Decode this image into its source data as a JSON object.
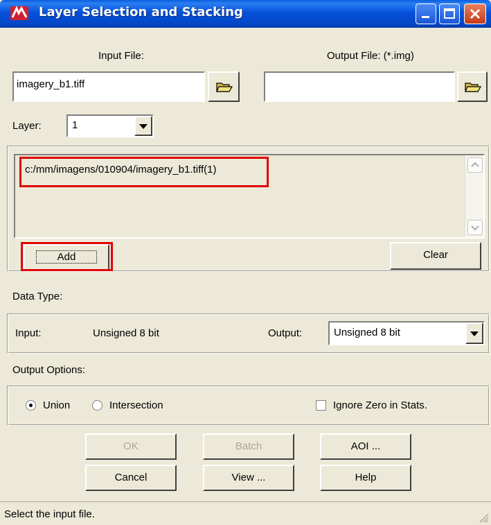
{
  "window": {
    "title": "Layer Selection and Stacking"
  },
  "input_file": {
    "label": "Input File:",
    "value": "imagery_b1.tiff"
  },
  "output_file": {
    "label": "Output File: (*.img)",
    "value": ""
  },
  "layer": {
    "label": "Layer:",
    "selected": "1"
  },
  "layer_list": {
    "items": [
      "c:/mm/imagens/010904/imagery_b1.tiff(1)"
    ]
  },
  "buttons": {
    "add": "Add",
    "clear": "Clear",
    "ok": "OK",
    "batch": "Batch",
    "aoi": "AOI ...",
    "cancel": "Cancel",
    "view": "View ...",
    "help": "Help"
  },
  "data_type": {
    "heading": "Data Type:",
    "input_label": "Input:",
    "input_value": "Unsigned 8 bit",
    "output_label": "Output:",
    "output_value": "Unsigned 8 bit"
  },
  "output_options": {
    "heading": "Output Options:",
    "union": "Union",
    "intersection": "Intersection",
    "selected": "Union",
    "ignore_zero": "Ignore Zero in Stats.",
    "ignore_zero_checked": false
  },
  "status": {
    "text": "Select the input file."
  },
  "colors": {
    "highlight_red": "#e00000",
    "title_blue": "#0550d9"
  }
}
